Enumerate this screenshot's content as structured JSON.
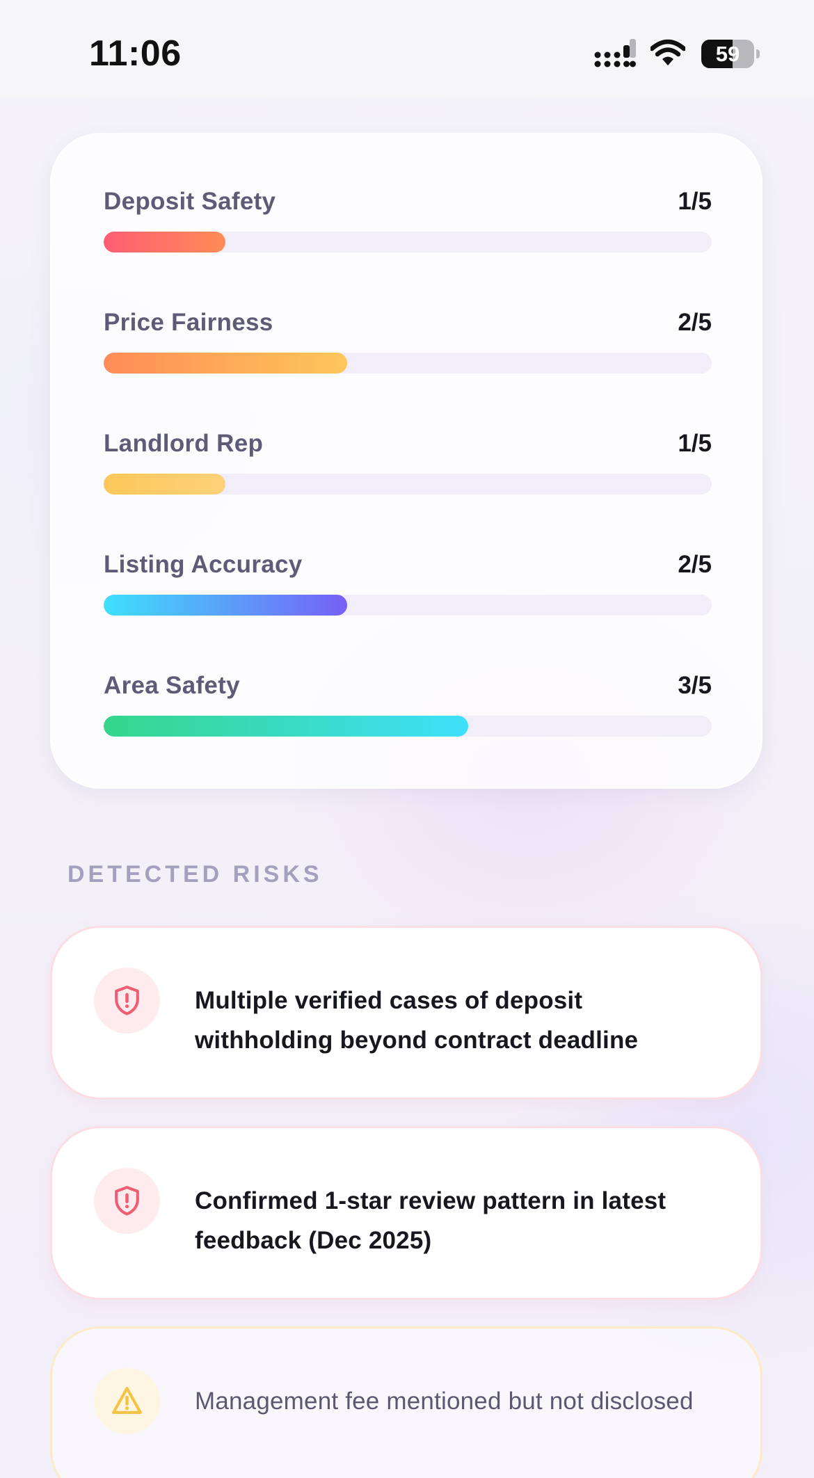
{
  "status_bar": {
    "time": "11:06",
    "battery_level": "59",
    "battery_fraction": 0.59,
    "icons": [
      "cellular-signal-icon",
      "wifi-icon",
      "battery-icon"
    ]
  },
  "scores": [
    {
      "label": "Deposit Safety",
      "value": "1/5",
      "score": 1,
      "max": 5,
      "gradient": [
        "#ff5d73",
        "#ff8c57"
      ]
    },
    {
      "label": "Price Fairness",
      "value": "2/5",
      "score": 2,
      "max": 5,
      "gradient": [
        "#ff8c57",
        "#fdc75a"
      ]
    },
    {
      "label": "Landlord Rep",
      "value": "1/5",
      "score": 1,
      "max": 5,
      "gradient": [
        "#fdc75a",
        "#fdd27a"
      ]
    },
    {
      "label": "Listing Accuracy",
      "value": "2/5",
      "score": 2,
      "max": 5,
      "gradient": [
        "#3ee0fb",
        "#7760f6"
      ]
    },
    {
      "label": "Area Safety",
      "value": "3/5",
      "score": 3,
      "max": 5,
      "gradient": [
        "#35d68a",
        "#3ee0fb"
      ]
    }
  ],
  "risks_section": {
    "heading": "DETECTED RISKS",
    "items": [
      {
        "severity": "high",
        "icon": "shield-alert-icon",
        "text": "Multiple verified cases of deposit withholding beyond contract deadline"
      },
      {
        "severity": "high",
        "icon": "shield-alert-icon",
        "text": "Confirmed 1-star review pattern in latest feedback (Dec 2025)"
      },
      {
        "severity": "medium",
        "icon": "warning-triangle-icon",
        "text": "Management fee mentioned but not disclosed"
      }
    ]
  },
  "colors": {
    "high_risk_icon": "#ef5d73",
    "medium_risk_icon": "#f5c244",
    "track": "#f1eef9"
  }
}
